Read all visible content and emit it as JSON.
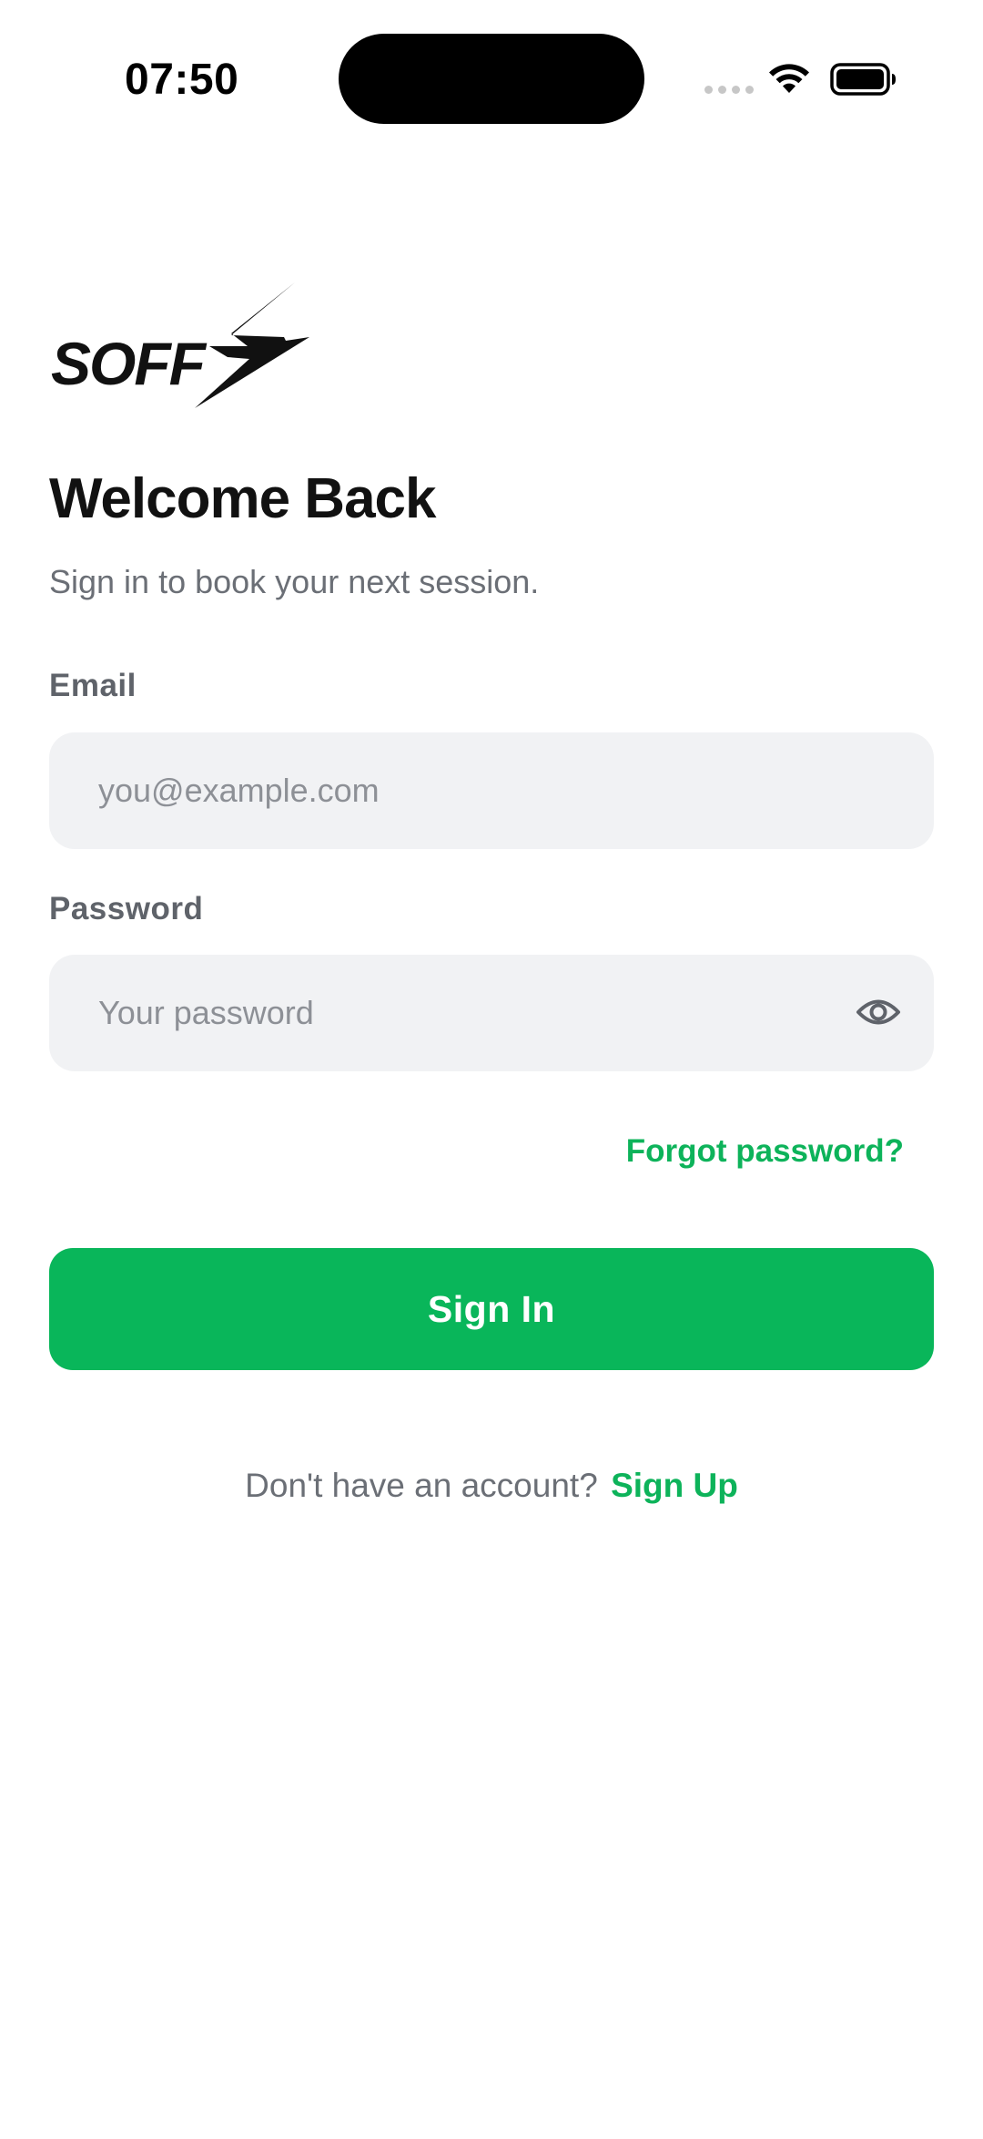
{
  "status_bar": {
    "time": "07:50"
  },
  "logo": {
    "text": "SOFF",
    "color": "#111111"
  },
  "header": {
    "title": "Welcome Back",
    "subtitle": "Sign in to book your next session."
  },
  "form": {
    "email": {
      "label": "Email",
      "placeholder": "you@example.com",
      "value": ""
    },
    "password": {
      "label": "Password",
      "placeholder": "Your password",
      "value": "",
      "toggle_icon": "eye-icon"
    },
    "forgot_label": "Forgot password?",
    "submit_label": "Sign In"
  },
  "footer": {
    "prompt": "Don't have an account?",
    "signup_label": "Sign Up"
  },
  "colors": {
    "accent": "#09b65a",
    "link": "#0db35a",
    "field_background": "#f1f2f4",
    "muted_text": "#6b6f76"
  }
}
